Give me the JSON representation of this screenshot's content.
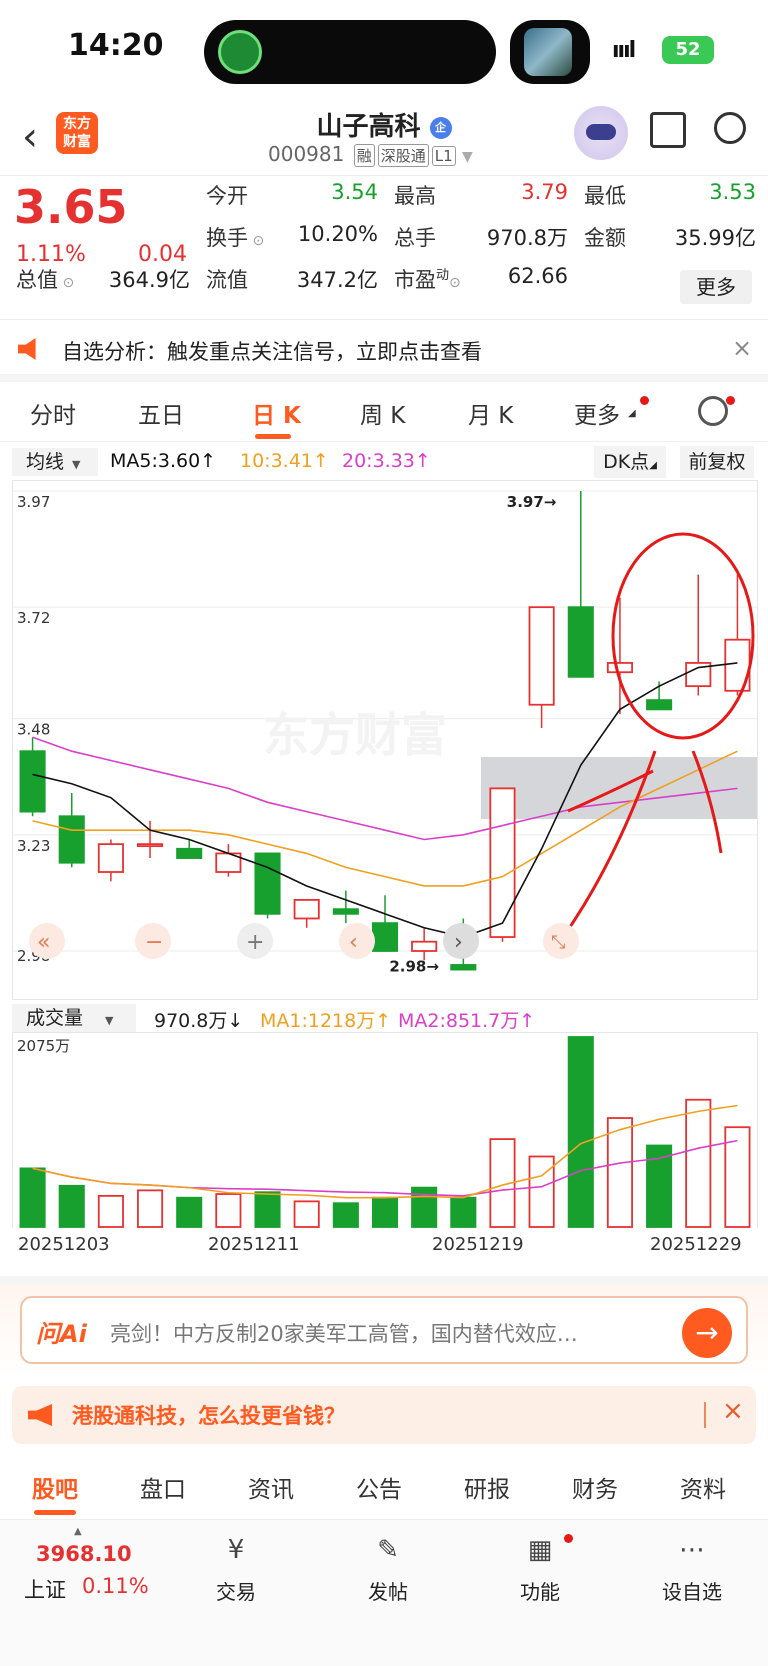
{
  "status": {
    "time": "14:20",
    "signal": "ıııl",
    "battery": "52"
  },
  "header": {
    "back_icon": "chevron-left-icon",
    "logo_text_line1": "东方",
    "logo_text_line2": "财富",
    "stock_name": "山子高科",
    "badge": "企",
    "code": "000981",
    "tags": [
      "融",
      "深股通",
      "L1"
    ]
  },
  "quote": {
    "price": "3.65",
    "change_pct": "1.11%",
    "change": "0.04",
    "open_label": "今开",
    "open": "3.54",
    "high_label": "最高",
    "high": "3.79",
    "low_label": "最低",
    "low": "3.53",
    "turnover_label": "换手",
    "turnover": "10.20%",
    "volume_label": "总手",
    "volume": "970.8万",
    "amount_label": "金额",
    "amount": "35.99亿",
    "total_cap_label": "总值",
    "total_cap": "364.9亿",
    "float_cap_label": "流值",
    "float_cap": "347.2亿",
    "pe_label": "市盈",
    "pe_sup": "动",
    "pe": "62.66",
    "more_button": "更多"
  },
  "notice": {
    "text": "自选分析：触发重点关注信号，立即点击查看",
    "close": "×"
  },
  "kline_tabs": {
    "items": [
      "分时",
      "五日",
      "日 K",
      "周 K",
      "月 K",
      "更多"
    ],
    "active": "日 K"
  },
  "ma_row": {
    "selector": "均线",
    "ma5": "MA5:3.60↑",
    "ma10": "10:3.41↑",
    "ma20": "20:3.33↑",
    "dk_button": "DK点",
    "adjust_button": "前复权",
    "ma5_color": "#111111",
    "ma10_color": "#f0a020",
    "ma20_color": "#d940c8"
  },
  "chart_data": {
    "type": "candlestick",
    "y_ticks": [
      "3.97",
      "3.72",
      "3.48",
      "3.23",
      "2.98"
    ],
    "ylim": [
      2.98,
      3.97
    ],
    "high_marker": "3.97→",
    "low_marker": "2.98→",
    "watermark": "东方财富",
    "candles": [
      {
        "o": 3.41,
        "h": 3.44,
        "l": 3.27,
        "c": 3.28
      },
      {
        "o": 3.27,
        "h": 3.32,
        "l": 3.16,
        "c": 3.17
      },
      {
        "o": 3.15,
        "h": 3.22,
        "l": 3.13,
        "c": 3.21
      },
      {
        "o": 3.21,
        "h": 3.26,
        "l": 3.18,
        "c": 3.21
      },
      {
        "o": 3.2,
        "h": 3.22,
        "l": 3.18,
        "c": 3.18
      },
      {
        "o": 3.15,
        "h": 3.21,
        "l": 3.14,
        "c": 3.19
      },
      {
        "o": 3.19,
        "h": 3.19,
        "l": 3.05,
        "c": 3.06
      },
      {
        "o": 3.05,
        "h": 3.09,
        "l": 3.03,
        "c": 3.09
      },
      {
        "o": 3.07,
        "h": 3.11,
        "l": 3.04,
        "c": 3.06
      },
      {
        "o": 3.04,
        "h": 3.1,
        "l": 2.98,
        "c": 2.98
      },
      {
        "o": 2.98,
        "h": 3.03,
        "l": 2.96,
        "c": 3.0
      },
      {
        "o": 2.95,
        "h": 3.05,
        "l": 2.94,
        "c": 2.94
      },
      {
        "o": 3.01,
        "h": 3.33,
        "l": 3.0,
        "c": 3.33
      },
      {
        "o": 3.51,
        "h": 3.71,
        "l": 3.46,
        "c": 3.72
      },
      {
        "o": 3.72,
        "h": 3.97,
        "l": 3.6,
        "c": 3.57
      },
      {
        "o": 3.58,
        "h": 3.74,
        "l": 3.49,
        "c": 3.6
      },
      {
        "o": 3.52,
        "h": 3.56,
        "l": 3.52,
        "c": 3.5
      },
      {
        "o": 3.55,
        "h": 3.79,
        "l": 3.53,
        "c": 3.6
      },
      {
        "o": 3.54,
        "h": 3.79,
        "l": 3.53,
        "c": 3.65
      }
    ],
    "ma5": [
      3.36,
      3.34,
      3.31,
      3.24,
      3.22,
      3.19,
      3.16,
      3.12,
      3.09,
      3.06,
      3.03,
      3.01,
      3.04,
      3.2,
      3.38,
      3.5,
      3.55,
      3.59,
      3.6
    ],
    "ma10": [
      3.26,
      3.24,
      3.24,
      3.24,
      3.24,
      3.23,
      3.21,
      3.19,
      3.16,
      3.14,
      3.12,
      3.12,
      3.14,
      3.19,
      3.24,
      3.29,
      3.33,
      3.37,
      3.41
    ],
    "ma20": [
      3.44,
      3.41,
      3.39,
      3.37,
      3.35,
      3.33,
      3.3,
      3.28,
      3.26,
      3.24,
      3.22,
      3.23,
      3.25,
      3.27,
      3.29,
      3.3,
      3.31,
      3.32,
      3.33
    ]
  },
  "volume": {
    "selector": "成交量",
    "current": "970.8万↓",
    "ma1": "MA1:1218万↑",
    "ma2": "MA2:851.7万↑",
    "max_label": "2075万",
    "bars": [
      {
        "v": 640,
        "up": false
      },
      {
        "v": 450,
        "up": false
      },
      {
        "v": 340,
        "up": true
      },
      {
        "v": 400,
        "up": true
      },
      {
        "v": 320,
        "up": false
      },
      {
        "v": 360,
        "up": true
      },
      {
        "v": 380,
        "up": false
      },
      {
        "v": 280,
        "up": true
      },
      {
        "v": 260,
        "up": false
      },
      {
        "v": 320,
        "up": false
      },
      {
        "v": 430,
        "up": false
      },
      {
        "v": 320,
        "up": false
      },
      {
        "v": 960,
        "up": true
      },
      {
        "v": 770,
        "up": true
      },
      {
        "v": 2075,
        "up": false
      },
      {
        "v": 1190,
        "up": true
      },
      {
        "v": 890,
        "up": false
      },
      {
        "v": 1390,
        "up": true
      },
      {
        "v": 1090,
        "up": true
      }
    ],
    "dates": [
      "20251203",
      "20251211",
      "20251219",
      "20251229"
    ]
  },
  "ai_bar": {
    "logo": "问Ai",
    "text": "亮剑！中方反制20家美军工高管，国内替代效应…",
    "go_icon": "arrow-right-icon"
  },
  "promo": {
    "text": "港股通科技，怎么投更省钱？",
    "close": "×"
  },
  "bottom_tabs": {
    "items": [
      "股吧",
      "盘口",
      "资讯",
      "公告",
      "研报",
      "财务",
      "资料"
    ],
    "active": "股吧"
  },
  "footer": {
    "index_value": "3968.10",
    "index_name": "上证",
    "index_pct": "0.11%",
    "nav": [
      {
        "label": "交易",
        "icon": "yen-icon"
      },
      {
        "label": "发帖",
        "icon": "edit-icon"
      },
      {
        "label": "功能",
        "icon": "grid-icon"
      },
      {
        "label": "设自选",
        "icon": "more-icon"
      }
    ]
  }
}
